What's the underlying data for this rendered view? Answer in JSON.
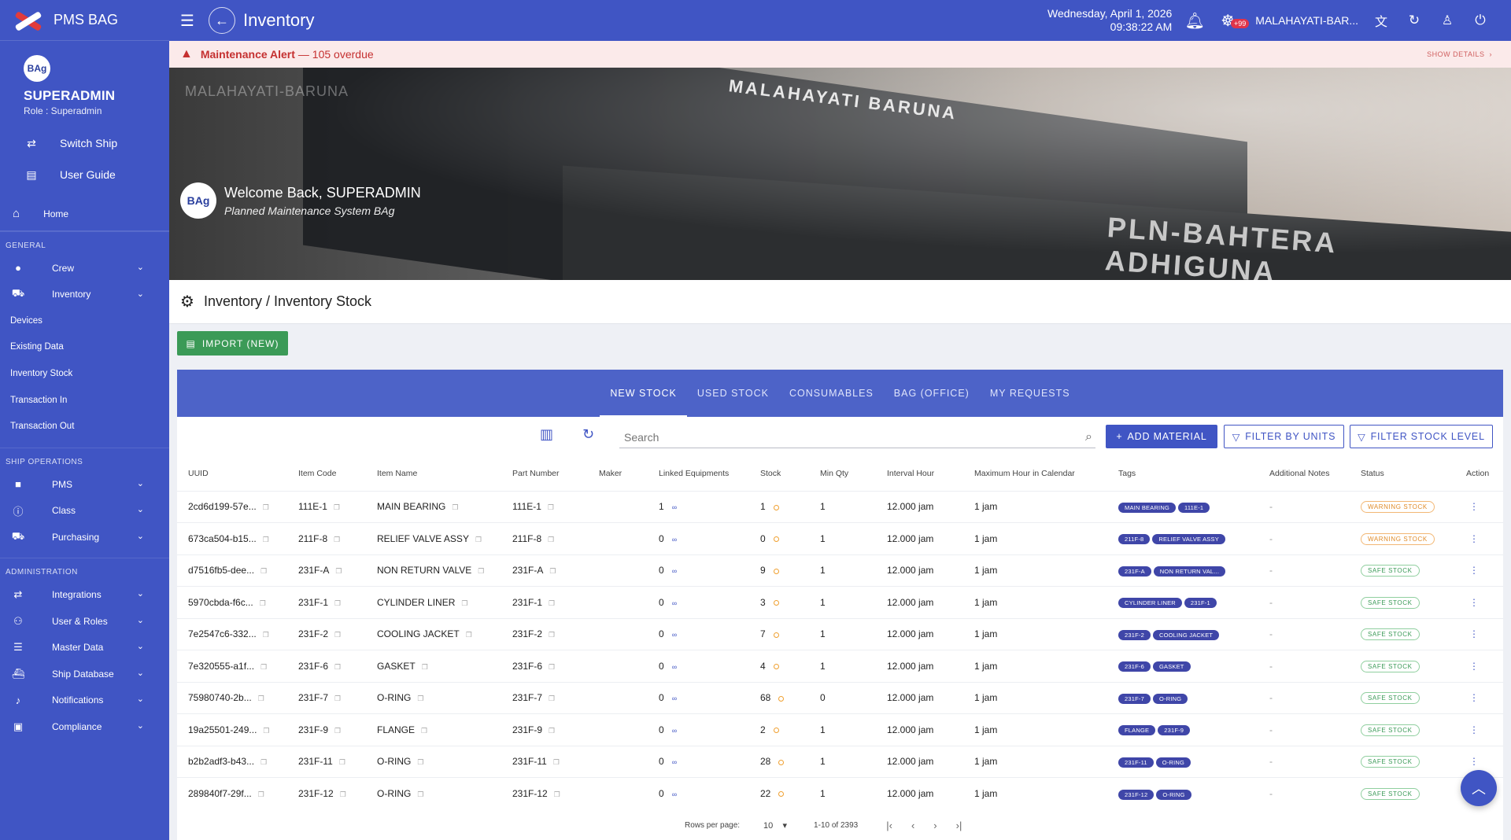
{
  "app": {
    "name": "PMS BAG"
  },
  "user": {
    "avatar_text": "BAg",
    "name": "SUPERADMIN",
    "role": "Role : Superadmin"
  },
  "sidebar": {
    "actions": [
      {
        "label": "Switch Ship",
        "icon": "swap-icon"
      },
      {
        "label": "User Guide",
        "icon": "document-icon"
      }
    ],
    "home": "Home",
    "sections": {
      "general": "GENERAL",
      "ship_operations": "SHIP OPERATIONS",
      "administration": "ADMINISTRATION"
    },
    "general": [
      {
        "label": "Crew",
        "icon": "person-icon"
      },
      {
        "label": "Inventory",
        "icon": "cart-icon"
      }
    ],
    "inventory_sub": [
      "Devices",
      "Existing Data",
      "Inventory Stock",
      "Transaction In",
      "Transaction Out"
    ],
    "ship_operations": [
      {
        "label": "PMS",
        "icon": "briefcase-icon"
      },
      {
        "label": "Class",
        "icon": "info-icon"
      },
      {
        "label": "Purchasing",
        "icon": "cart-icon"
      }
    ],
    "administration": [
      {
        "label": "Integrations",
        "icon": "swap-icon"
      },
      {
        "label": "User & Roles",
        "icon": "users-icon"
      },
      {
        "label": "Master Data",
        "icon": "database-icon"
      },
      {
        "label": "Ship Database",
        "icon": "ship-icon"
      },
      {
        "label": "Notifications",
        "icon": "bell-icon"
      },
      {
        "label": "Compliance",
        "icon": "shield-icon"
      }
    ]
  },
  "topbar": {
    "title": "Inventory",
    "date": "Wednesday, April 1, 2026",
    "time": "09:38:22 AM",
    "badge": "+99",
    "ship": "MALAHAYATI-BAR..."
  },
  "alert": {
    "title": "Maintenance Alert",
    "detail": "— 105 overdue",
    "action": "SHOW DETAILS"
  },
  "banner": {
    "ship_name": "MALAHAYATI BARUNA",
    "ship_name_faint": "MALAHAYATI-BARUNA",
    "ship_side": "PLN-BAHTERA ADHIGUNA",
    "avatar_text": "BAg",
    "welcome": "Welcome Back, SUPERADMIN",
    "subtitle": "Planned Maintenance System BAg"
  },
  "page": {
    "title": "Inventory / Inventory Stock",
    "import_label": "IMPORT (NEW)"
  },
  "tabs": [
    {
      "label": "NEW STOCK",
      "active": true
    },
    {
      "label": "USED STOCK"
    },
    {
      "label": "CONSUMABLES"
    },
    {
      "label": "BAG (OFFICE)"
    },
    {
      "label": "MY REQUESTS"
    }
  ],
  "toolbar": {
    "search_placeholder": "Search",
    "add_material": "ADD MATERIAL",
    "filter_units": "FILTER BY UNITS",
    "filter_stock": "FILTER STOCK LEVEL"
  },
  "columns": [
    "UUID",
    "Item Code",
    "Item Name",
    "Part Number",
    "Maker",
    "Linked Equipments",
    "Stock",
    "Min Qty",
    "Interval Hour",
    "Maximum Hour in Calendar",
    "Tags",
    "Additional Notes",
    "Status",
    "Action"
  ],
  "rows": [
    {
      "uuid": "2cd6d199-57e...",
      "code": "111E-1",
      "name": "MAIN BEARING",
      "part": "111E-1",
      "maker": "",
      "linked": "1",
      "stock": "1",
      "min": "1",
      "interval": "12.000 jam",
      "maxhour": "1 jam",
      "tags": [
        "MAIN BEARING",
        "111E-1"
      ],
      "notes": "-",
      "status": "WARNING STOCK",
      "status_type": "warn"
    },
    {
      "uuid": "673ca504-b15...",
      "code": "211F-8",
      "name": "RELIEF VALVE ASSY",
      "part": "211F-8",
      "maker": "",
      "linked": "0",
      "stock": "0",
      "min": "1",
      "interval": "12.000 jam",
      "maxhour": "1 jam",
      "tags": [
        "211F-8",
        "RELIEF VALVE ASSY"
      ],
      "notes": "-",
      "status": "WARNING STOCK",
      "status_type": "warn"
    },
    {
      "uuid": "d7516fb5-dee...",
      "code": "231F-A",
      "name": "NON RETURN VALVE",
      "part": "231F-A",
      "maker": "",
      "linked": "0",
      "stock": "9",
      "min": "1",
      "interval": "12.000 jam",
      "maxhour": "1 jam",
      "tags": [
        "231F-A",
        "NON RETURN VAL..."
      ],
      "notes": "-",
      "status": "SAFE STOCK",
      "status_type": "safe"
    },
    {
      "uuid": "5970cbda-f6c...",
      "code": "231F-1",
      "name": "CYLINDER LINER",
      "part": "231F-1",
      "maker": "",
      "linked": "0",
      "stock": "3",
      "min": "1",
      "interval": "12.000 jam",
      "maxhour": "1 jam",
      "tags": [
        "CYLINDER LINER",
        "231F-1"
      ],
      "notes": "-",
      "status": "SAFE STOCK",
      "status_type": "safe"
    },
    {
      "uuid": "7e2547c6-332...",
      "code": "231F-2",
      "name": "COOLING JACKET",
      "part": "231F-2",
      "maker": "",
      "linked": "0",
      "stock": "7",
      "min": "1",
      "interval": "12.000 jam",
      "maxhour": "1 jam",
      "tags": [
        "231F-2",
        "COOLING JACKET"
      ],
      "notes": "-",
      "status": "SAFE STOCK",
      "status_type": "safe"
    },
    {
      "uuid": "7e320555-a1f...",
      "code": "231F-6",
      "name": "GASKET",
      "part": "231F-6",
      "maker": "",
      "linked": "0",
      "stock": "4",
      "min": "1",
      "interval": "12.000 jam",
      "maxhour": "1 jam",
      "tags": [
        "231F-6",
        "GASKET"
      ],
      "notes": "-",
      "status": "SAFE STOCK",
      "status_type": "safe"
    },
    {
      "uuid": "75980740-2b...",
      "code": "231F-7",
      "name": "O-RING",
      "part": "231F-7",
      "maker": "",
      "linked": "0",
      "stock": "68",
      "min": "0",
      "interval": "12.000 jam",
      "maxhour": "1 jam",
      "tags": [
        "231F-7",
        "O-RING"
      ],
      "notes": "-",
      "status": "SAFE STOCK",
      "status_type": "safe"
    },
    {
      "uuid": "19a25501-249...",
      "code": "231F-9",
      "name": "FLANGE",
      "part": "231F-9",
      "maker": "",
      "linked": "0",
      "stock": "2",
      "min": "1",
      "interval": "12.000 jam",
      "maxhour": "1 jam",
      "tags": [
        "FLANGE",
        "231F-9"
      ],
      "notes": "-",
      "status": "SAFE STOCK",
      "status_type": "safe"
    },
    {
      "uuid": "b2b2adf3-b43...",
      "code": "231F-11",
      "name": "O-RING",
      "part": "231F-11",
      "maker": "",
      "linked": "0",
      "stock": "28",
      "min": "1",
      "interval": "12.000 jam",
      "maxhour": "1 jam",
      "tags": [
        "231F-11",
        "O-RING"
      ],
      "notes": "-",
      "status": "SAFE STOCK",
      "status_type": "safe"
    },
    {
      "uuid": "289840f7-29f...",
      "code": "231F-12",
      "name": "O-RING",
      "part": "231F-12",
      "maker": "",
      "linked": "0",
      "stock": "22",
      "min": "1",
      "interval": "12.000 jam",
      "maxhour": "1 jam",
      "tags": [
        "231F-12",
        "O-RING"
      ],
      "notes": "-",
      "status": "SAFE STOCK",
      "status_type": "safe"
    }
  ],
  "pagination": {
    "rows_label": "Rows per page:",
    "rows_value": "10",
    "range": "1-10 of 2393"
  },
  "colors": {
    "primary": "#4055c4",
    "tab_bar": "#4d63c8",
    "success": "#3b9a57",
    "warning": "#e08c2a",
    "alert_bg": "#fbeaea"
  }
}
